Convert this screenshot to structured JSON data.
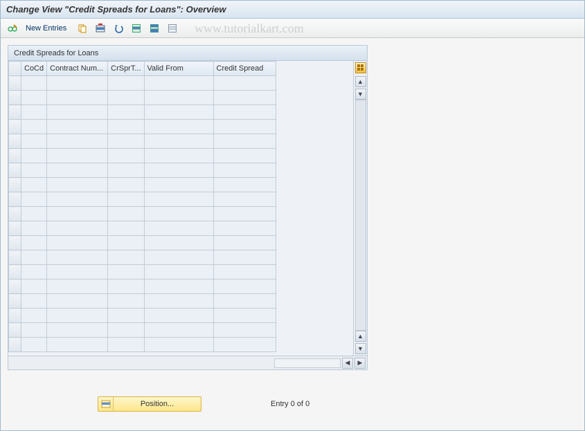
{
  "title": "Change View \"Credit Spreads for Loans\": Overview",
  "toolbar": {
    "new_entries_label": "New Entries"
  },
  "watermark": "www.tutorialkart.com",
  "panel": {
    "title": "Credit Spreads for Loans",
    "columns": [
      "CoCd",
      "Contract Num...",
      "CrSprT...",
      "Valid From",
      "Credit Spread"
    ],
    "rows": [
      [
        "",
        "",
        "",
        "",
        ""
      ],
      [
        "",
        "",
        "",
        "",
        ""
      ],
      [
        "",
        "",
        "",
        "",
        ""
      ],
      [
        "",
        "",
        "",
        "",
        ""
      ],
      [
        "",
        "",
        "",
        "",
        ""
      ],
      [
        "",
        "",
        "",
        "",
        ""
      ],
      [
        "",
        "",
        "",
        "",
        ""
      ],
      [
        "",
        "",
        "",
        "",
        ""
      ],
      [
        "",
        "",
        "",
        "",
        ""
      ],
      [
        "",
        "",
        "",
        "",
        ""
      ],
      [
        "",
        "",
        "",
        "",
        ""
      ],
      [
        "",
        "",
        "",
        "",
        ""
      ],
      [
        "",
        "",
        "",
        "",
        ""
      ],
      [
        "",
        "",
        "",
        "",
        ""
      ],
      [
        "",
        "",
        "",
        "",
        ""
      ],
      [
        "",
        "",
        "",
        "",
        ""
      ],
      [
        "",
        "",
        "",
        "",
        ""
      ],
      [
        "",
        "",
        "",
        "",
        ""
      ],
      [
        "",
        "",
        "",
        "",
        ""
      ]
    ]
  },
  "footer": {
    "position_label": "Position...",
    "status": "Entry 0 of 0"
  }
}
